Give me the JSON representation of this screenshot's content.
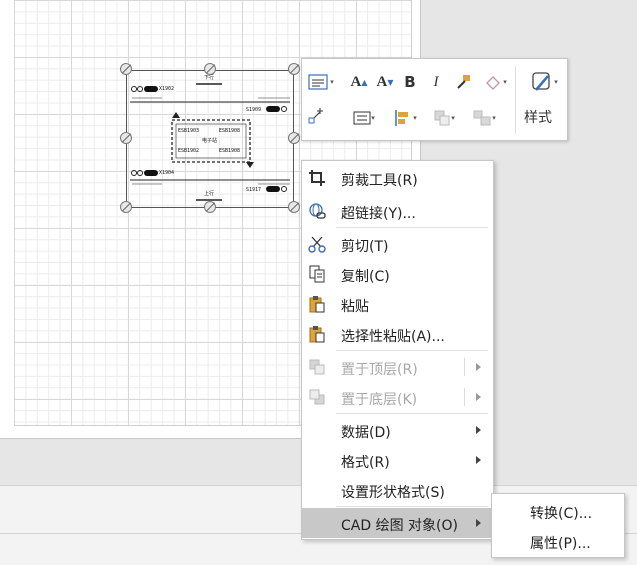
{
  "cad_drawing": {
    "labels": [
      "X1902",
      "S1909",
      "ESB1903",
      "ESB1908",
      "ESB1902",
      "ESB1908",
      "X1904",
      "S1917",
      "上行",
      "下行",
      "电子站"
    ]
  },
  "mini_toolbar": {
    "style_label": "样式",
    "buttons": [
      {
        "name": "shape-styles-icon"
      },
      {
        "name": "font-increase-icon",
        "glyph": "A"
      },
      {
        "name": "font-decrease-icon",
        "glyph": "A"
      },
      {
        "name": "bold-icon",
        "glyph": "B"
      },
      {
        "name": "italic-icon",
        "glyph": "I"
      },
      {
        "name": "format-painter-icon"
      },
      {
        "name": "fill-icon"
      },
      {
        "name": "connector-icon"
      },
      {
        "name": "align-icon"
      },
      {
        "name": "position-icon"
      },
      {
        "name": "bring-forward-icon"
      },
      {
        "name": "group-icon"
      }
    ]
  },
  "context_menu": {
    "items": [
      {
        "label": "剪裁工具(R)",
        "icon": "crop-icon",
        "enabled": true,
        "submenu": false
      },
      {
        "label": "超链接(Y)...",
        "icon": "hyperlink-icon",
        "enabled": true,
        "submenu": false
      },
      {
        "label": "剪切(T)",
        "icon": "cut-icon",
        "enabled": true,
        "submenu": false
      },
      {
        "label": "复制(C)",
        "icon": "copy-icon",
        "enabled": true,
        "submenu": false
      },
      {
        "label": "粘贴",
        "icon": "paste-icon",
        "enabled": true,
        "submenu": false
      },
      {
        "label": "选择性粘贴(A)...",
        "icon": "paste-special-icon",
        "enabled": true,
        "submenu": false
      },
      {
        "label": "置于顶层(R)",
        "icon": "bring-to-front-icon",
        "enabled": false,
        "submenu": true
      },
      {
        "label": "置于底层(K)",
        "icon": "send-to-back-icon",
        "enabled": false,
        "submenu": true
      },
      {
        "label": "数据(D)",
        "icon": "",
        "enabled": true,
        "submenu": true
      },
      {
        "label": "格式(R)",
        "icon": "",
        "enabled": true,
        "submenu": true
      },
      {
        "label": "设置形状格式(S)",
        "icon": "",
        "enabled": true,
        "submenu": false
      },
      {
        "label": "CAD 绘图 对象(O)",
        "icon": "",
        "enabled": true,
        "submenu": true,
        "highlighted": true
      }
    ]
  },
  "submenu": {
    "items": [
      {
        "label": "转换(C)..."
      },
      {
        "label": "属性(P)..."
      }
    ]
  }
}
